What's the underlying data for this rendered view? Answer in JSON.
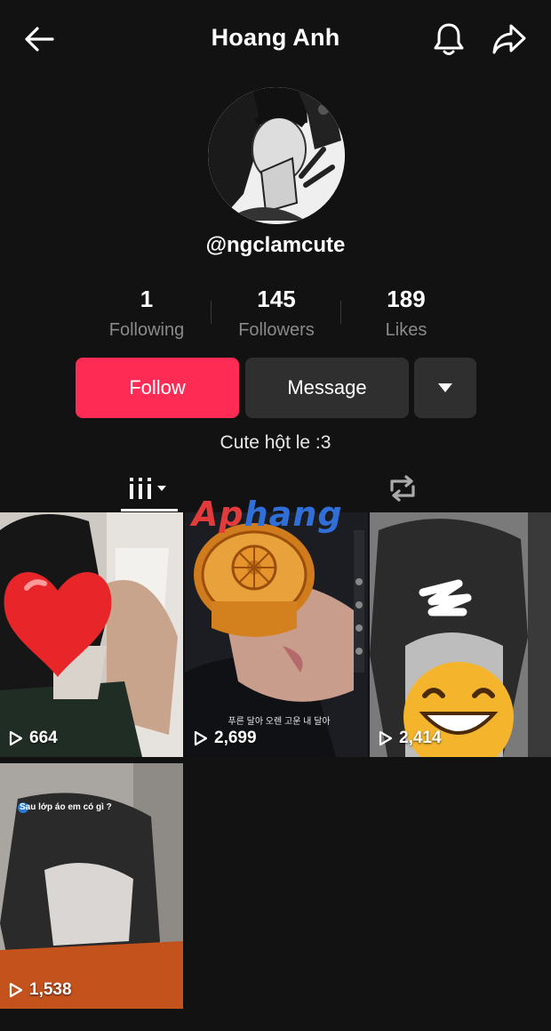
{
  "header": {
    "title": "Hoang Anh",
    "back_icon": "back-arrow-icon",
    "bell_icon": "bell-icon",
    "share_icon": "share-arrow-icon"
  },
  "profile": {
    "username": "@ngclamcute",
    "bio": "Cute hột le :3"
  },
  "stats": [
    {
      "value": "1",
      "label": "Following"
    },
    {
      "value": "145",
      "label": "Followers"
    },
    {
      "value": "189",
      "label": "Likes"
    }
  ],
  "actions": {
    "follow_label": "Follow",
    "message_label": "Message",
    "follow_color": "#fe2c55"
  },
  "tabs": {
    "videos_icon": "grid-icon",
    "reposts_icon": "repost-icon"
  },
  "watermark": {
    "part1": "Ap",
    "part2": "hang"
  },
  "videos": [
    {
      "views": "664"
    },
    {
      "views": "2,699",
      "caption": "푸른 달아 오렌 고운 내 달아"
    },
    {
      "views": "2,414"
    },
    {
      "views": "1,538",
      "caption": "Sau lớp áo em có gì ?"
    }
  ]
}
